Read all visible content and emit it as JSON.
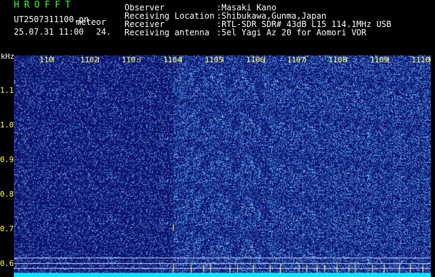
{
  "header": {
    "app_title": "HROFFT",
    "file_name": "UT2507311100.pn",
    "meteor_label": "meteor",
    "datetime": "25.07.31 11:00",
    "count": "24.",
    "rows": [
      {
        "label": "Observer",
        "value": ":Masaki Kano"
      },
      {
        "label": "Receiving Location",
        "value": ":Shibukawa,Gunma,Japan"
      },
      {
        "label": "Receiver",
        "value": ":RTL-SDR SDR# 43dB L15 114.1MHz USB"
      },
      {
        "label": "Receiving antenna",
        "value": ":5el Yagi Az 20 for Aomori VOR"
      }
    ]
  },
  "axes": {
    "y_unit": "kHz",
    "x_ticks": [
      "110",
      "1102",
      "110:",
      "1104",
      "1105",
      "1106",
      "1107",
      "1108",
      "1109",
      "1110"
    ],
    "y_ticks": [
      "1.1",
      "1.0",
      "0.9",
      "0.8",
      "0.7",
      "0.6"
    ]
  },
  "colors": {
    "background": "#000000",
    "spectrogram_base": "#0a0a6e",
    "noise": "#3a6cff",
    "tick": "#ffff66",
    "title": "#3cff3c",
    "baseline": "#00e5ff"
  }
}
